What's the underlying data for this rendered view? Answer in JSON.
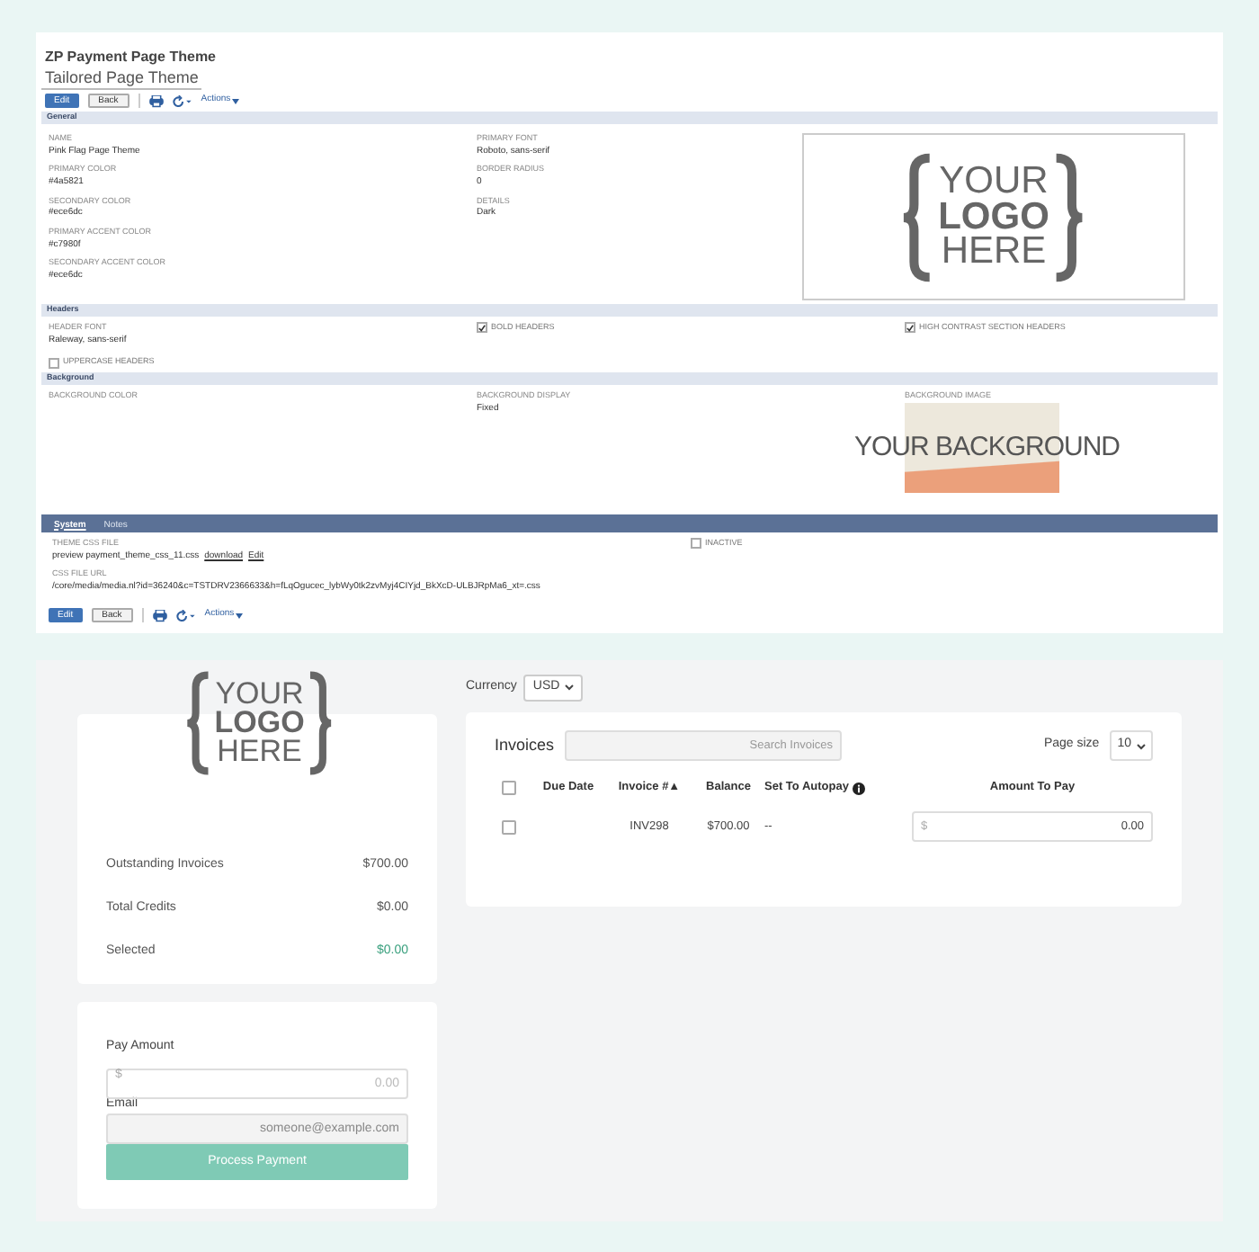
{
  "record": {
    "title": "ZP Payment Page Theme",
    "subtitle": "Tailored Page Theme"
  },
  "toolbars": [
    {
      "edit": "Edit",
      "back": "Back",
      "actions": "Actions"
    },
    {
      "edit": "Edit",
      "back": "Back",
      "actions": "Actions"
    }
  ],
  "general": {
    "heading": "General",
    "column_1": [
      {
        "label": "NAME",
        "value": "Pink Flag Page Theme"
      },
      {
        "label": "PRIMARY COLOR",
        "value": "#4a5821"
      },
      {
        "label": "SECONDARY COLOR",
        "value": "#ece6dc"
      },
      {
        "label": "PRIMARY ACCENT COLOR",
        "value": "#c7980f"
      },
      {
        "label": "SECONDARY ACCENT COLOR",
        "value": "#ece6dc"
      }
    ],
    "column_2": [
      {
        "label": "PRIMARY FONT",
        "value": "Roboto, sans-serif"
      },
      {
        "label": "BORDER RADIUS",
        "value": "0"
      },
      {
        "label": "DETAILS",
        "value": "Dark"
      }
    ],
    "logo": [
      "YOUR",
      "LOGO",
      "HERE"
    ]
  },
  "headers": {
    "heading": "Headers",
    "header_font": {
      "label": "HEADER FONT",
      "value": "Raleway, sans-serif"
    },
    "checkboxes": [
      {
        "label": "UPPERCASE HEADERS",
        "checked": false
      },
      {
        "label": "BOLD HEADERS",
        "checked": true
      },
      {
        "label": "HIGH CONTRAST SECTION HEADERS",
        "checked": true
      }
    ]
  },
  "background": {
    "heading": "Background",
    "color_label": "BACKGROUND COLOR",
    "display": {
      "label": "BACKGROUND DISPLAY",
      "value": "Fixed"
    },
    "image_label": "BACKGROUND IMAGE",
    "image_text": "YOUR BACKGROUND"
  },
  "tabs": [
    {
      "label": "System",
      "selected": true
    },
    {
      "label": "Notes",
      "selected": false
    }
  ],
  "system": {
    "css_file": {
      "label": "THEME CSS FILE",
      "value": "preview payment_theme_css_11.css",
      "links": [
        "download",
        "Edit"
      ]
    },
    "inactive": {
      "label": "INACTIVE",
      "checked": false
    },
    "css_url": {
      "label": "CSS FILE URL",
      "value": "/core/media/media.nl?id=36240&c=TSTDRV2366633&h=fLqOgucec_lybWy0tk2zvMyj4CIYjd_BkXcD-ULBJRpMa6_xt=.css"
    }
  },
  "portal": {
    "logo": [
      "YOUR",
      "LOGO",
      "HERE"
    ],
    "summary": [
      {
        "label": "Outstanding Invoices",
        "value": "$700.00",
        "color": "#555555"
      },
      {
        "label": "Total Credits",
        "value": "$0.00",
        "color": "#555555"
      },
      {
        "label": "Selected",
        "value": "$0.00",
        "color": "#3aa07e"
      }
    ],
    "pay": {
      "amount_label": "Pay Amount",
      "prefix": "$",
      "amount_placeholder": "0.00",
      "email_label": "Email",
      "email_placeholder": "someone@example.com",
      "button": "Process Payment"
    },
    "currency": {
      "label": "Currency",
      "value": "USD"
    },
    "invoices": {
      "title": "Invoices",
      "search_placeholder": "Search Invoices",
      "page_size_label": "Page size",
      "page_size": "10",
      "columns": [
        "Due Date",
        "Invoice #▲",
        "Balance",
        "Set To Autopay",
        "Amount To Pay"
      ],
      "header_checked": false,
      "rows": [
        {
          "checked": false,
          "due_date": "",
          "invoice": "INV298",
          "balance": "$700.00",
          "autopay": "--",
          "prefix": "$",
          "amount": "0.00"
        }
      ]
    }
  }
}
